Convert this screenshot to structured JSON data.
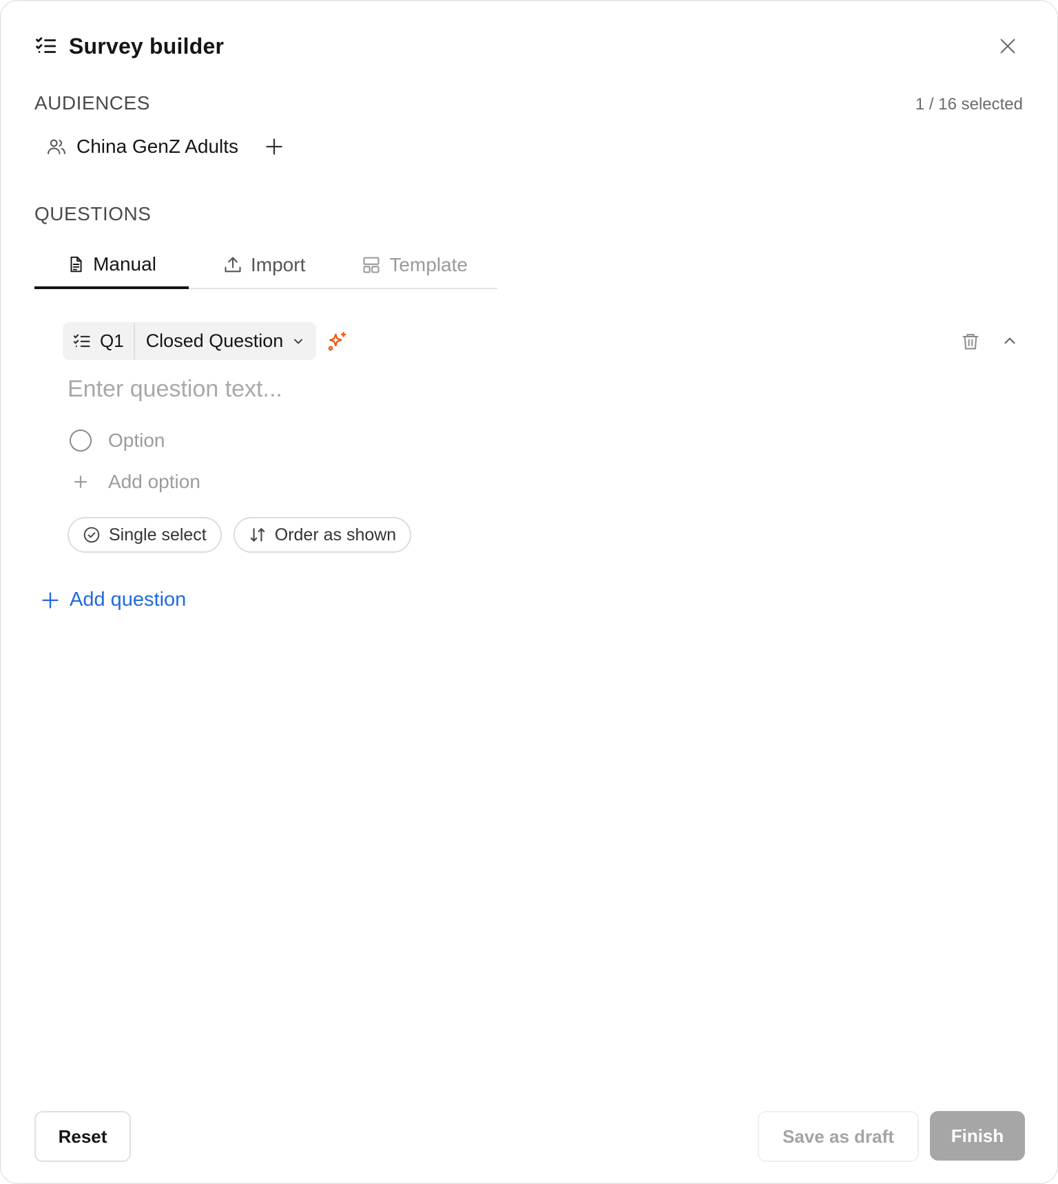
{
  "header": {
    "title": "Survey builder",
    "icon": "checklist-icon"
  },
  "audiences": {
    "label": "AUDIENCES",
    "selected_count": "1 / 16 selected",
    "items": [
      {
        "name": "China GenZ Adults",
        "icon": "users-icon"
      }
    ]
  },
  "questions": {
    "label": "QUESTIONS",
    "tabs": [
      {
        "label": "Manual",
        "icon": "document-icon",
        "active": true
      },
      {
        "label": "Import",
        "icon": "upload-icon",
        "active": false
      },
      {
        "label": "Template",
        "icon": "template-icon",
        "active": false
      }
    ],
    "items": [
      {
        "number": "Q1",
        "type": "Closed Question",
        "placeholder": "Enter question text...",
        "options": [
          {
            "placeholder": "Option"
          }
        ],
        "add_option_label": "Add option",
        "settings": {
          "select_mode": "Single select",
          "order": "Order as shown"
        }
      }
    ],
    "add_question_label": "Add question"
  },
  "footer": {
    "reset_label": "Reset",
    "draft_label": "Save as draft",
    "finish_label": "Finish"
  },
  "colors": {
    "accent_link": "#1f6ae0",
    "ai_sparkle": "#f05a0f",
    "finish_disabled": "#a6a6a6"
  }
}
